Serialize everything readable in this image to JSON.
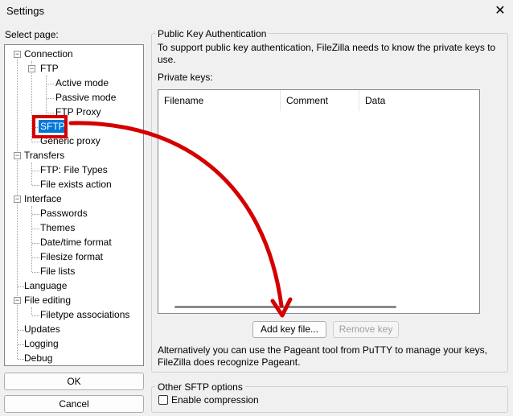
{
  "window": {
    "title": "Settings",
    "close_glyph": "✕"
  },
  "sidebar": {
    "label": "Select page:",
    "tree": {
      "connection": "Connection",
      "ftp": "FTP",
      "active_mode": "Active mode",
      "passive_mode": "Passive mode",
      "ftp_proxy": "FTP Proxy",
      "sftp": "SFTP",
      "generic_proxy": "Generic proxy",
      "transfers": "Transfers",
      "ftp_file_types": "FTP: File Types",
      "file_exists_action": "File exists action",
      "interface": "Interface",
      "passwords": "Passwords",
      "themes": "Themes",
      "datetime_format": "Date/time format",
      "filesize_format": "Filesize format",
      "file_lists": "File lists",
      "language": "Language",
      "file_editing": "File editing",
      "filetype_associations": "Filetype associations",
      "updates": "Updates",
      "logging": "Logging",
      "debug": "Debug"
    },
    "ok_label": "OK",
    "cancel_label": "Cancel"
  },
  "pka": {
    "title": "Public Key Authentication",
    "description": "To support public key authentication, FileZilla needs to know the private keys to use.",
    "private_keys_label": "Private keys:",
    "columns": [
      "Filename",
      "Comment",
      "Data"
    ],
    "add_key_label": "Add key file...",
    "remove_key_label": "Remove key",
    "pageant_note": "Alternatively you can use the Pageant tool from PuTTY to manage your keys, FileZilla does recognize Pageant."
  },
  "other": {
    "title": "Other SFTP options",
    "enable_compression_label": "Enable compression",
    "enable_compression_checked": false
  },
  "annotation": {
    "color": "#d40000"
  }
}
